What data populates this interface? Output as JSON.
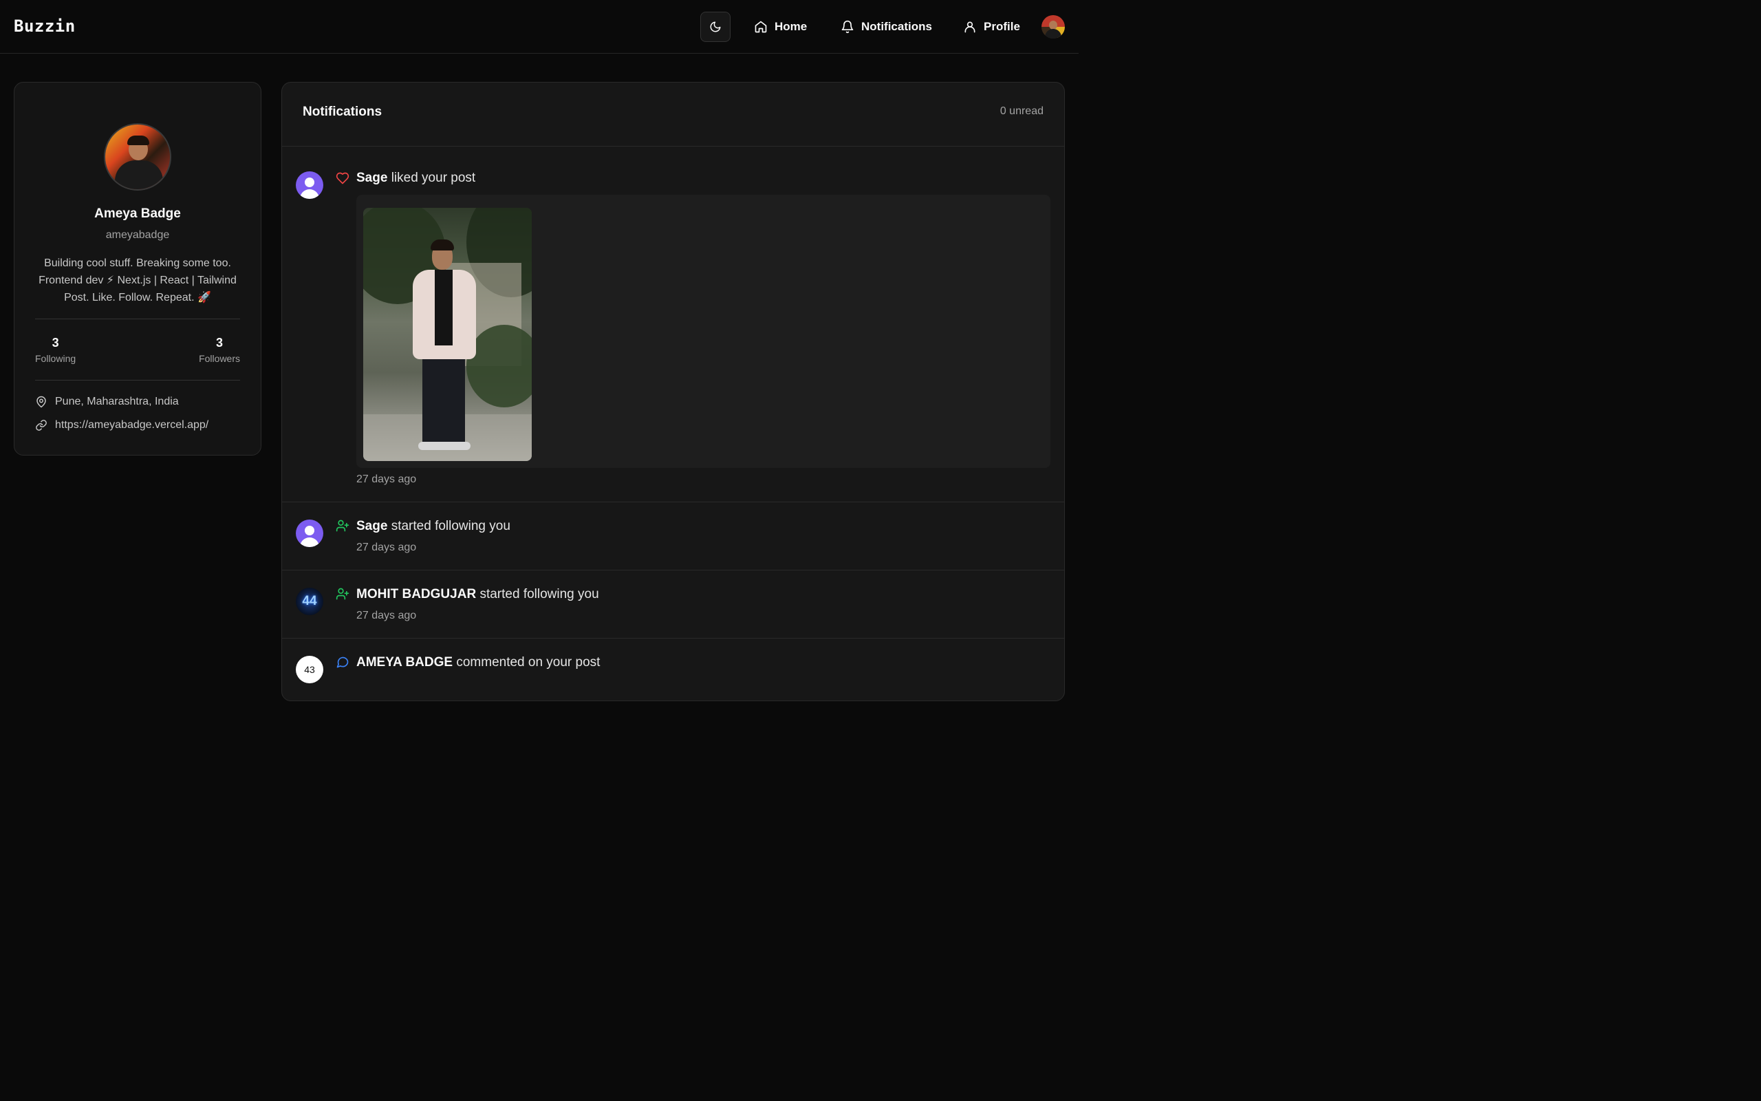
{
  "app": {
    "brand": "Buzzin",
    "nav": [
      {
        "label": "Home",
        "icon": "home-icon"
      },
      {
        "label": "Notifications",
        "icon": "bell-icon"
      },
      {
        "label": "Profile",
        "icon": "user-icon"
      }
    ],
    "theme_icon": "moon-icon"
  },
  "profile": {
    "name": "Ameya Badge",
    "handle": "ameyabadge",
    "bio": "Building cool stuff. Breaking some too. Frontend dev ⚡ Next.js | React | Tailwind Post. Like. Follow. Repeat. 🚀",
    "following_count": "3",
    "following_label": "Following",
    "followers_count": "3",
    "followers_label": "Followers",
    "location": "Pune, Maharashtra, India",
    "website": "https://ameyabadge.vercel.app/"
  },
  "notifications": {
    "title": "Notifications",
    "unread": "0 unread",
    "items": [
      {
        "actor": "Sage",
        "action": "liked your post",
        "time": "27 days ago",
        "type": "like",
        "icon_color": "#ef4444"
      },
      {
        "actor": "Sage",
        "action": "started following you",
        "time": "27 days ago",
        "type": "follow",
        "icon_color": "#22c55e"
      },
      {
        "actor": "MOHIT BADGUJAR",
        "action": "started following you",
        "time": "27 days ago",
        "type": "follow",
        "avatar_text": "44",
        "icon_color": "#22c55e"
      },
      {
        "actor": "AMEYA BADGE",
        "action": "commented on your post",
        "type": "comment",
        "avatar_text": "43",
        "icon_color": "#3b82f6"
      }
    ]
  }
}
